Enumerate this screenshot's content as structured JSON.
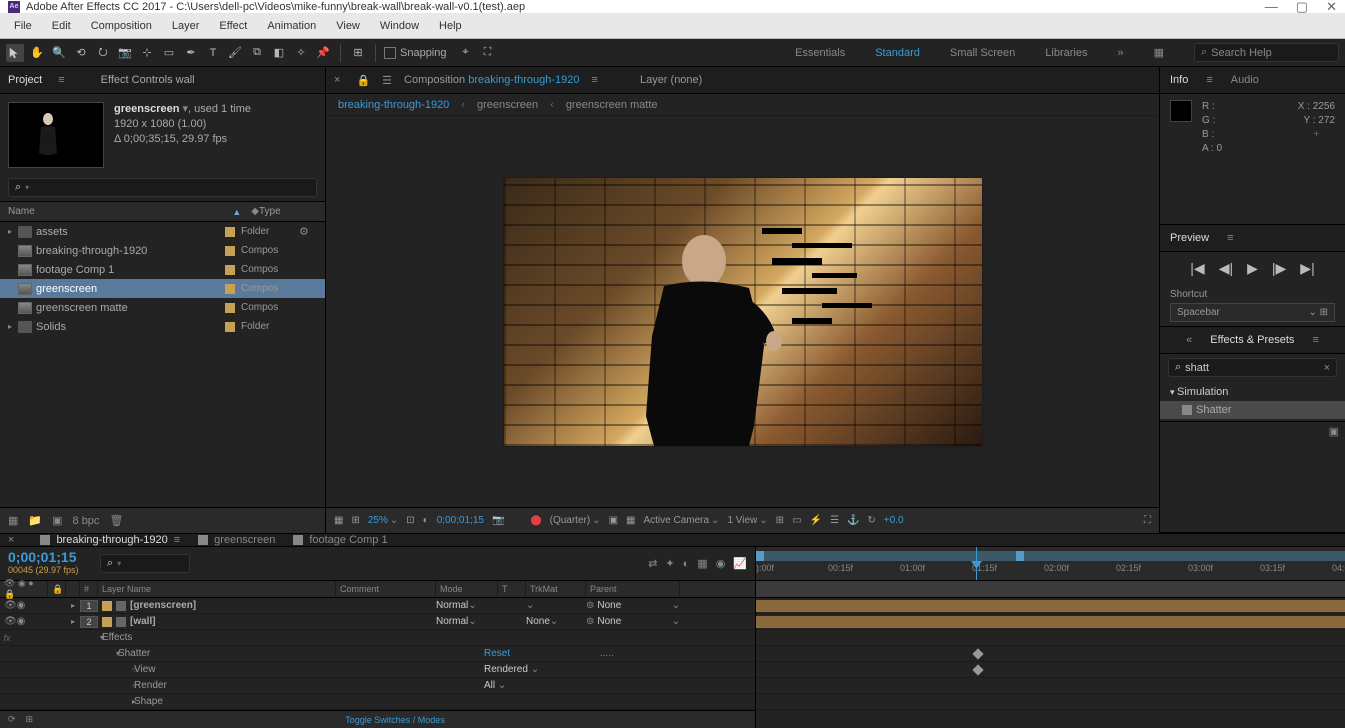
{
  "titlebar": {
    "app": "Ae",
    "title": "Adobe After Effects CC 2017 - C:\\Users\\dell-pc\\Videos\\mike-funny\\break-wall\\break-wall-v0.1(test).aep"
  },
  "menubar": [
    "File",
    "Edit",
    "Composition",
    "Layer",
    "Effect",
    "Animation",
    "View",
    "Window",
    "Help"
  ],
  "toolbar": {
    "snapping": "Snapping",
    "workspaces": [
      "Essentials",
      "Standard",
      "Small Screen",
      "Libraries"
    ],
    "active_workspace": "Standard",
    "search_placeholder": "Search Help"
  },
  "project_panel": {
    "tabs": [
      "Project",
      "Effect Controls wall"
    ],
    "active_tab": "Project",
    "info": {
      "name": "greenscreen",
      "usage": ", used 1 time",
      "dims": "1920 x 1080 (1.00)",
      "duration": "Δ 0;00;35;15, 29.97 fps"
    },
    "columns": {
      "name": "Name",
      "type": "Type"
    },
    "items": [
      {
        "name": "assets",
        "type": "Folder",
        "icon": "folder",
        "arrow": "▸",
        "extras": "⚙"
      },
      {
        "name": "breaking-through-1920",
        "type": "Compos",
        "icon": "comp",
        "arrow": ""
      },
      {
        "name": "footage Comp 1",
        "type": "Compos",
        "icon": "comp",
        "arrow": ""
      },
      {
        "name": "greenscreen",
        "type": "Compos",
        "icon": "comp",
        "arrow": "",
        "selected": true
      },
      {
        "name": "greenscreen matte",
        "type": "Compos",
        "icon": "comp",
        "arrow": ""
      },
      {
        "name": "Solids",
        "type": "Folder",
        "icon": "folder",
        "arrow": "▸"
      }
    ],
    "footer_bpc": "8 bpc"
  },
  "comp_panel": {
    "prefix": "Composition",
    "name": "breaking-through-1920",
    "layer_none": "Layer (none)",
    "breadcrumb": [
      "breaking-through-1920",
      "greenscreen",
      "greenscreen matte"
    ]
  },
  "viewer_footer": {
    "zoom": "25%",
    "timecode": "0;00;01;15",
    "quality": "(Quarter)",
    "camera": "Active Camera",
    "views": "1 View",
    "exposure": "+0.0"
  },
  "info_panel": {
    "tabs": [
      "Info",
      "Audio"
    ],
    "R": "R :",
    "G": "G :",
    "B": "B :",
    "A": "A :  0",
    "X": "X : 2256",
    "Y": "Y :  272"
  },
  "preview_panel": {
    "tab": "Preview",
    "shortcut_label": "Shortcut",
    "shortcut_value": "Spacebar"
  },
  "effects_panel": {
    "tab": "Effects & Presets",
    "search": "shatt",
    "category": "Simulation",
    "effect": "Shatter"
  },
  "timeline": {
    "tabs": [
      "breaking-through-1920",
      "greenscreen",
      "footage Comp 1"
    ],
    "active_tab": "breaking-through-1920",
    "timecode": "0;00;01;15",
    "frame_info": "00045 (29.97 fps)",
    "columns": {
      "layer_name": "Layer Name",
      "comment": "Comment",
      "mode": "Mode",
      "t": "T",
      "trkmat": "TrkMat",
      "parent": "Parent"
    },
    "layers": [
      {
        "num": "1",
        "name": "[greenscreen]",
        "tag": "#c5a055",
        "mode": "Normal",
        "trk": "",
        "parent": "None"
      },
      {
        "num": "2",
        "name": "[wall]",
        "tag": "#c5a055",
        "mode": "Normal",
        "trk": "None",
        "parent": "None"
      }
    ],
    "props": [
      {
        "name": "Effects",
        "arrow": "▾",
        "indent": 1
      },
      {
        "name": "Shatter",
        "arrow": "▾",
        "indent": 2,
        "reset": "Reset",
        "dots": "....."
      },
      {
        "name": "View",
        "arrow": "",
        "indent": 3,
        "value": "Rendered"
      },
      {
        "name": "Render",
        "arrow": "",
        "indent": 3,
        "value": "All"
      },
      {
        "name": "Shape",
        "arrow": "▸",
        "indent": 3
      }
    ],
    "ruler_ticks": [
      "):00f",
      "00:15f",
      "01:00f",
      "01:15f",
      "02:00f",
      "02:15f",
      "03:00f",
      "03:15f",
      "04:0"
    ],
    "toggle": "Toggle Switches / Modes"
  }
}
